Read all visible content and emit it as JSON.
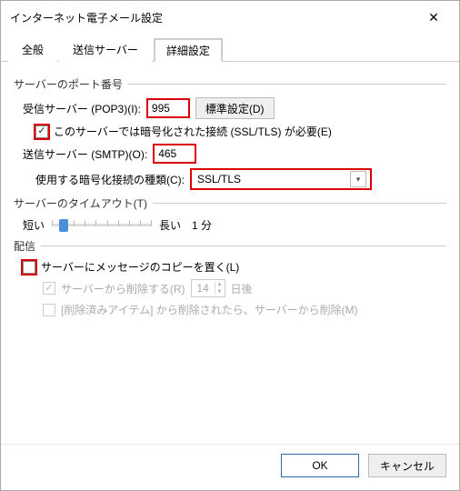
{
  "title": "インターネット電子メール設定",
  "tabs": {
    "general": "全般",
    "outgoing": "送信サーバー",
    "advanced": "詳細設定"
  },
  "groups": {
    "ports": "サーバーのポート番号",
    "timeout": "サーバーのタイムアウト(T)",
    "delivery": "配信"
  },
  "ports": {
    "pop3_label": "受信サーバー (POP3)(I):",
    "pop3_value": "995",
    "default_btn": "標準設定(D)",
    "ssl_required_label": "このサーバーでは暗号化された接続 (SSL/TLS) が必要(E)",
    "ssl_required_checked": true,
    "smtp_label": "送信サーバー (SMTP)(O):",
    "smtp_value": "465",
    "enc_label": "使用する暗号化接続の種類(C):",
    "enc_value": "SSL/TLS"
  },
  "timeout": {
    "short": "短い",
    "long": "長い",
    "value_label": "1 分"
  },
  "delivery": {
    "leave_copy_label": "サーバーにメッセージのコピーを置く(L)",
    "leave_copy_checked": false,
    "remove_after_label": "サーバーから削除する(R)",
    "remove_after_checked": true,
    "remove_after_days": "14",
    "days_suffix": "日後",
    "remove_deleted_label": "[削除済みアイテム] から削除されたら、サーバーから削除(M)",
    "remove_deleted_checked": false
  },
  "buttons": {
    "ok": "OK",
    "cancel": "キャンセル"
  }
}
